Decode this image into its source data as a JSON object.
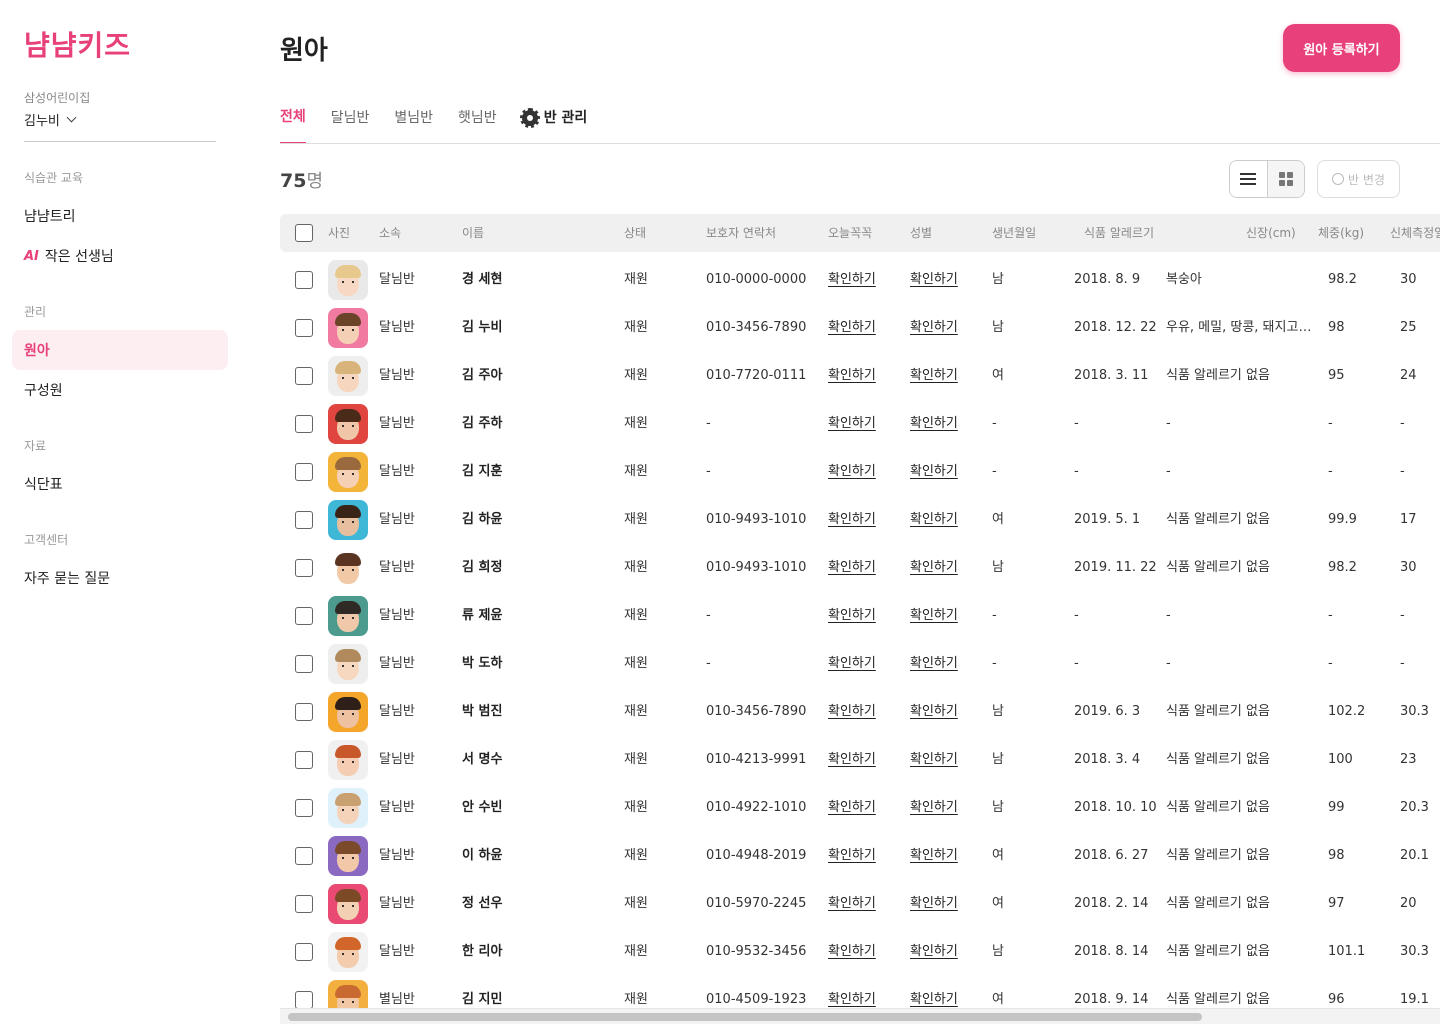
{
  "brand": {
    "logo_text": "냠냠키즈",
    "accent": "#e8407a"
  },
  "sidebar": {
    "org_name": "삼성어린이집",
    "user_name": "김누비",
    "sections": [
      {
        "title": "식습관 교육",
        "items": [
          {
            "label": "냠냠트리"
          },
          {
            "badge": "AI",
            "label": "작은 선생님"
          }
        ]
      },
      {
        "title": "관리",
        "items": [
          {
            "label": "원아",
            "active": true
          },
          {
            "label": "구성원"
          }
        ]
      },
      {
        "title": "자료",
        "items": [
          {
            "label": "식단표"
          }
        ]
      },
      {
        "title": "고객센터",
        "items": [
          {
            "label": "자주 묻는 질문"
          }
        ]
      }
    ]
  },
  "page": {
    "title": "원아",
    "register_button": "원아 등록하기",
    "tabs": [
      "전체",
      "달님반",
      "별님반",
      "햇님반"
    ],
    "manage_tab": "반 관리",
    "count_number": "75",
    "count_unit": "명",
    "class_change_button": "반 변경"
  },
  "table": {
    "headers": [
      "사진",
      "소속",
      "이름",
      "상태",
      "보호자 연락처",
      "오늘꼭꼭",
      "성별",
      "생년월일",
      "식품 알레르기",
      "신장(cm)",
      "체중(kg)",
      "신체측정일"
    ],
    "rows": [
      {
        "class": "달님반",
        "name": "경 세현",
        "status": "재원",
        "phone": "010-0000-0000",
        "today": "확인하기",
        "gender_link": "확인하기",
        "gender": "남",
        "birth": "2018. 8. 9",
        "allergy": "복숭아",
        "height": "98.2",
        "weight": "30",
        "avatar": {
          "bg": "#e9e9e9",
          "skin": "#f6d8c4",
          "hair": "#e8c98d"
        }
      },
      {
        "class": "달님반",
        "name": "김 누비",
        "status": "재원",
        "phone": "010-3456-7890",
        "today": "확인하기",
        "gender_link": "확인하기",
        "gender": "남",
        "birth": "2018. 12. 22",
        "allergy": "우유, 메밀, 땅콩, 돼지고기...",
        "height": "98",
        "weight": "25",
        "avatar": {
          "bg": "#f07aa0",
          "skin": "#f4cfb5",
          "hair": "#6b4327"
        }
      },
      {
        "class": "달님반",
        "name": "김 주아",
        "status": "재원",
        "phone": "010-7720-0111",
        "today": "확인하기",
        "gender_link": "확인하기",
        "gender": "여",
        "birth": "2018. 3. 11",
        "allergy": "식품 알레르기 없음",
        "height": "95",
        "weight": "24",
        "avatar": {
          "bg": "#eeeeee",
          "skin": "#f6d6bf",
          "hair": "#d9b47a"
        }
      },
      {
        "class": "달님반",
        "name": "김 주하",
        "status": "재원",
        "phone": "-",
        "today": "확인하기",
        "gender_link": "확인하기",
        "gender": "-",
        "birth": "-",
        "allergy": "-",
        "height": "-",
        "weight": "-",
        "avatar": {
          "bg": "#e0453f",
          "skin": "#f1c6a8",
          "hair": "#4a2a18"
        }
      },
      {
        "class": "달님반",
        "name": "김 지훈",
        "status": "재원",
        "phone": "-",
        "today": "확인하기",
        "gender_link": "확인하기",
        "gender": "-",
        "birth": "-",
        "allergy": "-",
        "height": "-",
        "weight": "-",
        "avatar": {
          "bg": "#f3b43a",
          "skin": "#f5d0b4",
          "hair": "#9a6a3e"
        }
      },
      {
        "class": "달님반",
        "name": "김 하윤",
        "status": "재원",
        "phone": "010-9493-1010",
        "today": "확인하기",
        "gender_link": "확인하기",
        "gender": "여",
        "birth": "2019. 5. 1",
        "allergy": "식품 알레르기 없음",
        "height": "99.9",
        "weight": "17",
        "avatar": {
          "bg": "#3fb8d8",
          "skin": "#e8bf9e",
          "hair": "#3a2418"
        }
      },
      {
        "class": "달님반",
        "name": "김 희정",
        "status": "재원",
        "phone": "010-9493-1010",
        "today": "확인하기",
        "gender_link": "확인하기",
        "gender": "남",
        "birth": "2019. 11. 22",
        "allergy": "식품 알레르기 없음",
        "height": "98.2",
        "weight": "30",
        "avatar": {
          "bg": "#ffffff",
          "skin": "#f2c9a6",
          "hair": "#5a3420"
        }
      },
      {
        "class": "달님반",
        "name": "류 제윤",
        "status": "재원",
        "phone": "-",
        "today": "확인하기",
        "gender_link": "확인하기",
        "gender": "-",
        "birth": "-",
        "allergy": "-",
        "height": "-",
        "weight": "-",
        "avatar": {
          "bg": "#4d9a8e",
          "skin": "#efc9aa",
          "hair": "#2f2a26"
        }
      },
      {
        "class": "달님반",
        "name": "박 도하",
        "status": "재원",
        "phone": "-",
        "today": "확인하기",
        "gender_link": "확인하기",
        "gender": "-",
        "birth": "-",
        "allergy": "-",
        "height": "-",
        "weight": "-",
        "avatar": {
          "bg": "#eeeeee",
          "skin": "#f6d7c0",
          "hair": "#b08a5c"
        }
      },
      {
        "class": "달님반",
        "name": "박 범진",
        "status": "재원",
        "phone": "010-3456-7890",
        "today": "확인하기",
        "gender_link": "확인하기",
        "gender": "남",
        "birth": "2019. 6. 3",
        "allergy": "식품 알레르기 없음",
        "height": "102.2",
        "weight": "30.3",
        "avatar": {
          "bg": "#f3a62a",
          "skin": "#eec2a0",
          "hair": "#2e2018"
        }
      },
      {
        "class": "달님반",
        "name": "서 명수",
        "status": "재원",
        "phone": "010-4213-9991",
        "today": "확인하기",
        "gender_link": "확인하기",
        "gender": "남",
        "birth": "2018. 3. 4",
        "allergy": "식품 알레르기 없음",
        "height": "100",
        "weight": "23",
        "avatar": {
          "bg": "#f0f0f0",
          "skin": "#f4cdb2",
          "hair": "#c8582a"
        }
      },
      {
        "class": "달님반",
        "name": "안 수빈",
        "status": "재원",
        "phone": "010-4922-1010",
        "today": "확인하기",
        "gender_link": "확인하기",
        "gender": "남",
        "birth": "2018. 10. 10",
        "allergy": "식품 알레르기 없음",
        "height": "99",
        "weight": "20.3",
        "avatar": {
          "bg": "#dff1fb",
          "skin": "#f5d3ba",
          "hair": "#c9a070"
        }
      },
      {
        "class": "달님반",
        "name": "이 하윤",
        "status": "재원",
        "phone": "010-4948-2019",
        "today": "확인하기",
        "gender_link": "확인하기",
        "gender": "여",
        "birth": "2018. 6. 27",
        "allergy": "식품 알레르기 없음",
        "height": "98",
        "weight": "20.1",
        "avatar": {
          "bg": "#8a6ac0",
          "skin": "#f2c8a8",
          "hair": "#7a4a2a"
        }
      },
      {
        "class": "달님반",
        "name": "정 선우",
        "status": "재원",
        "phone": "010-5970-2245",
        "today": "확인하기",
        "gender_link": "확인하기",
        "gender": "여",
        "birth": "2018. 2. 14",
        "allergy": "식품 알레르기 없음",
        "height": "97",
        "weight": "20",
        "avatar": {
          "bg": "#e94a73",
          "skin": "#f3cfb4",
          "hair": "#7d4a28"
        }
      },
      {
        "class": "달님반",
        "name": "한 리아",
        "status": "재원",
        "phone": "010-9532-3456",
        "today": "확인하기",
        "gender_link": "확인하기",
        "gender": "남",
        "birth": "2018. 8. 14",
        "allergy": "식품 알레르기 없음",
        "height": "101.1",
        "weight": "30.3",
        "avatar": {
          "bg": "#f2f2f2",
          "skin": "#f3cbad",
          "hair": "#d2662a"
        }
      },
      {
        "class": "별님반",
        "name": "김 지민",
        "status": "재원",
        "phone": "010-4509-1923",
        "today": "확인하기",
        "gender_link": "확인하기",
        "gender": "여",
        "birth": "2018. 9. 14",
        "allergy": "식품 알레르기 없음",
        "height": "96",
        "weight": "19.1",
        "avatar": {
          "bg": "#f3b03e",
          "skin": "#f2c7a6",
          "hair": "#c96a30"
        }
      }
    ]
  },
  "icons": {
    "dropdown": "chevron-down-icon",
    "manage": "gear-icon",
    "list_view": "list-view-icon",
    "grid_view": "grid-view-icon",
    "class_change": "settings-icon"
  }
}
